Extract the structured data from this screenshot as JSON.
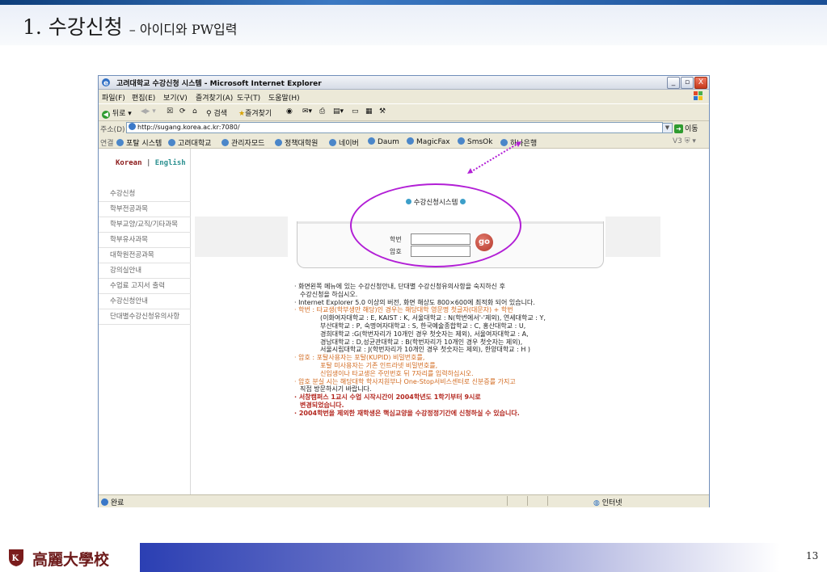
{
  "slide": {
    "title": "1. 수강신청",
    "subtitle": "– 아이디와 PW입력",
    "page_number": "13",
    "footer_text": "高麗大學校"
  },
  "window": {
    "title": "고려대학교 수강신청 시스템 - Microsoft Internet Explorer",
    "controls": [
      "_",
      "▫",
      "X"
    ]
  },
  "menu": {
    "items": [
      "파일(F)",
      "편집(E)",
      "보기(V)",
      "즐겨찾기(A)",
      "도구(T)",
      "도움말(H)"
    ]
  },
  "toolbar": {
    "back": "뒤로",
    "search": "검색",
    "favorites": "즐겨찾기"
  },
  "address": {
    "label": "주소(D)",
    "url": "http://sugang.korea.ac.kr:7080/",
    "go_label": "이동"
  },
  "links": {
    "label": "연결",
    "items": [
      "포탈 시스템",
      "고려대학교",
      "관리자모드",
      "정책대학원",
      "네이버",
      "Daum",
      "MagicFax",
      "SmsOk",
      "하나은행"
    ],
    "right": "V3 "
  },
  "page": {
    "lang_korean": "Korean",
    "lang_sep": "|",
    "lang_english": "English",
    "nav": [
      "수강신청",
      "학부전공과목",
      "학부교양/교직/기타과목",
      "학부유사과목",
      "대학원전공과목",
      "강의실안내",
      "수업료 고지서 출력",
      "수강신청안내",
      "단대별수강신청유의사항"
    ],
    "system_title": "수강신청시스템",
    "id_label": "학번",
    "pw_label": "암호",
    "go_button": "go",
    "notes": [
      "· 화면왼쪽 메뉴에 있는 수강신청안내, 단대별 수강신청유의사항을 숙지하신 후",
      "수강신청을 하십시오.",
      "· Internet Explorer 5.0 이상의 버전, 화면 해상도 800×600에 최적화 되어 있습니다.",
      "· 학번 : 타교생(학부생만 해당)인 경우는 해당대학 영문명 첫글자(대문자) + 학번",
      "(이화여자대학교 : E, KAIST : K, 서울대학교 : N(학번에서'-'제외), 연세대학교 : Y,",
      "부산대학교 : P, 숙명여자대학교 : S, 한국예술종합학교 : C, 홍산대학교 : U,",
      "경희대학교 :G(학번자리가 10개인 경우 첫숫자는 제외), 서울여자대학교 : A,",
      "경남대학교 : D,성균관대학교 : B(학번자리가 10개인 경우 첫숫자는 제외),",
      "서울시립대학교 : J(학번자리가 10개인 경우 첫숫자는 제외), 한양대학교 : H )",
      "· 암호 : 포탈사용자는 포탈(KUPID) 비밀번호를,",
      "포탈 미사용자는 기존 인트라넷 비밀번호를,",
      "신입생이나 타교생은 주민번호 뒤 7자리를 입력하십시오.",
      "· 암호 분실 시는 해당대학 학사지원부나 One-Stop서비스센터로 신분증를 가지고",
      "직접 방문하시기 바랍니다.",
      "· 서창캠퍼스 1교시 수업 시작시간이 2004학년도 1학기부터 9시로",
      "변경되었습니다.",
      "· 2004학번을 제외한 재학생은 핵심교양을 수강정정기간에 신청하실 수 있습니다."
    ]
  },
  "status": {
    "left": "완료",
    "right": "인터넷"
  },
  "colors": {
    "annotation": "#b21fd6",
    "go_button": "#c1473a",
    "footer_gradient_start": "#2b3fb3"
  }
}
